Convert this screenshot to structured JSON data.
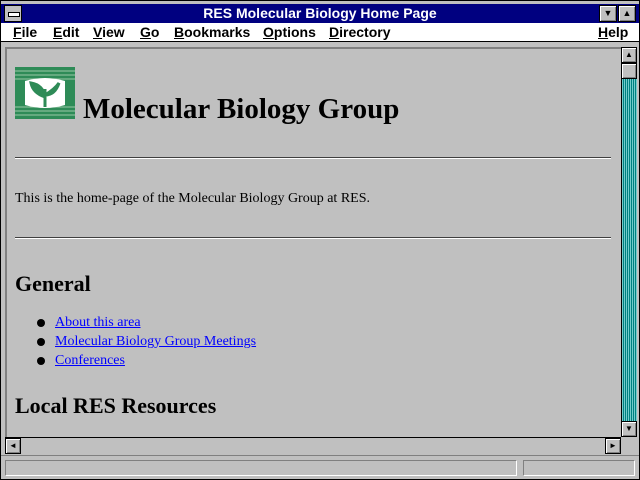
{
  "window": {
    "title": "RES Molecular Biology Home Page"
  },
  "menu": [
    {
      "label": "File",
      "u": "F",
      "rest": "ile"
    },
    {
      "label": "Edit",
      "u": "E",
      "rest": "dit"
    },
    {
      "label": "View",
      "u": "V",
      "rest": "iew"
    },
    {
      "label": "Go",
      "u": "G",
      "rest": "o"
    },
    {
      "label": "Bookmarks",
      "u": "B",
      "rest": "ookmarks"
    },
    {
      "label": "Options",
      "u": "O",
      "rest": "ptions"
    },
    {
      "label": "Directory",
      "u": "D",
      "rest": "irectory"
    },
    {
      "label": "Help",
      "u": "H",
      "rest": "elp"
    }
  ],
  "page": {
    "heading": "Molecular Biology Group",
    "intro": "This is the home-page of the Molecular Biology Group at RES.",
    "section_general": "General",
    "links": [
      "About this area",
      "Molecular Biology Group Meetings",
      "Conferences"
    ],
    "section_local": "Local RES Resources"
  },
  "status": {
    "text": ""
  },
  "colors": {
    "titlebar": "#000080",
    "link": "#0000ff",
    "logo": "#2e8b57"
  }
}
